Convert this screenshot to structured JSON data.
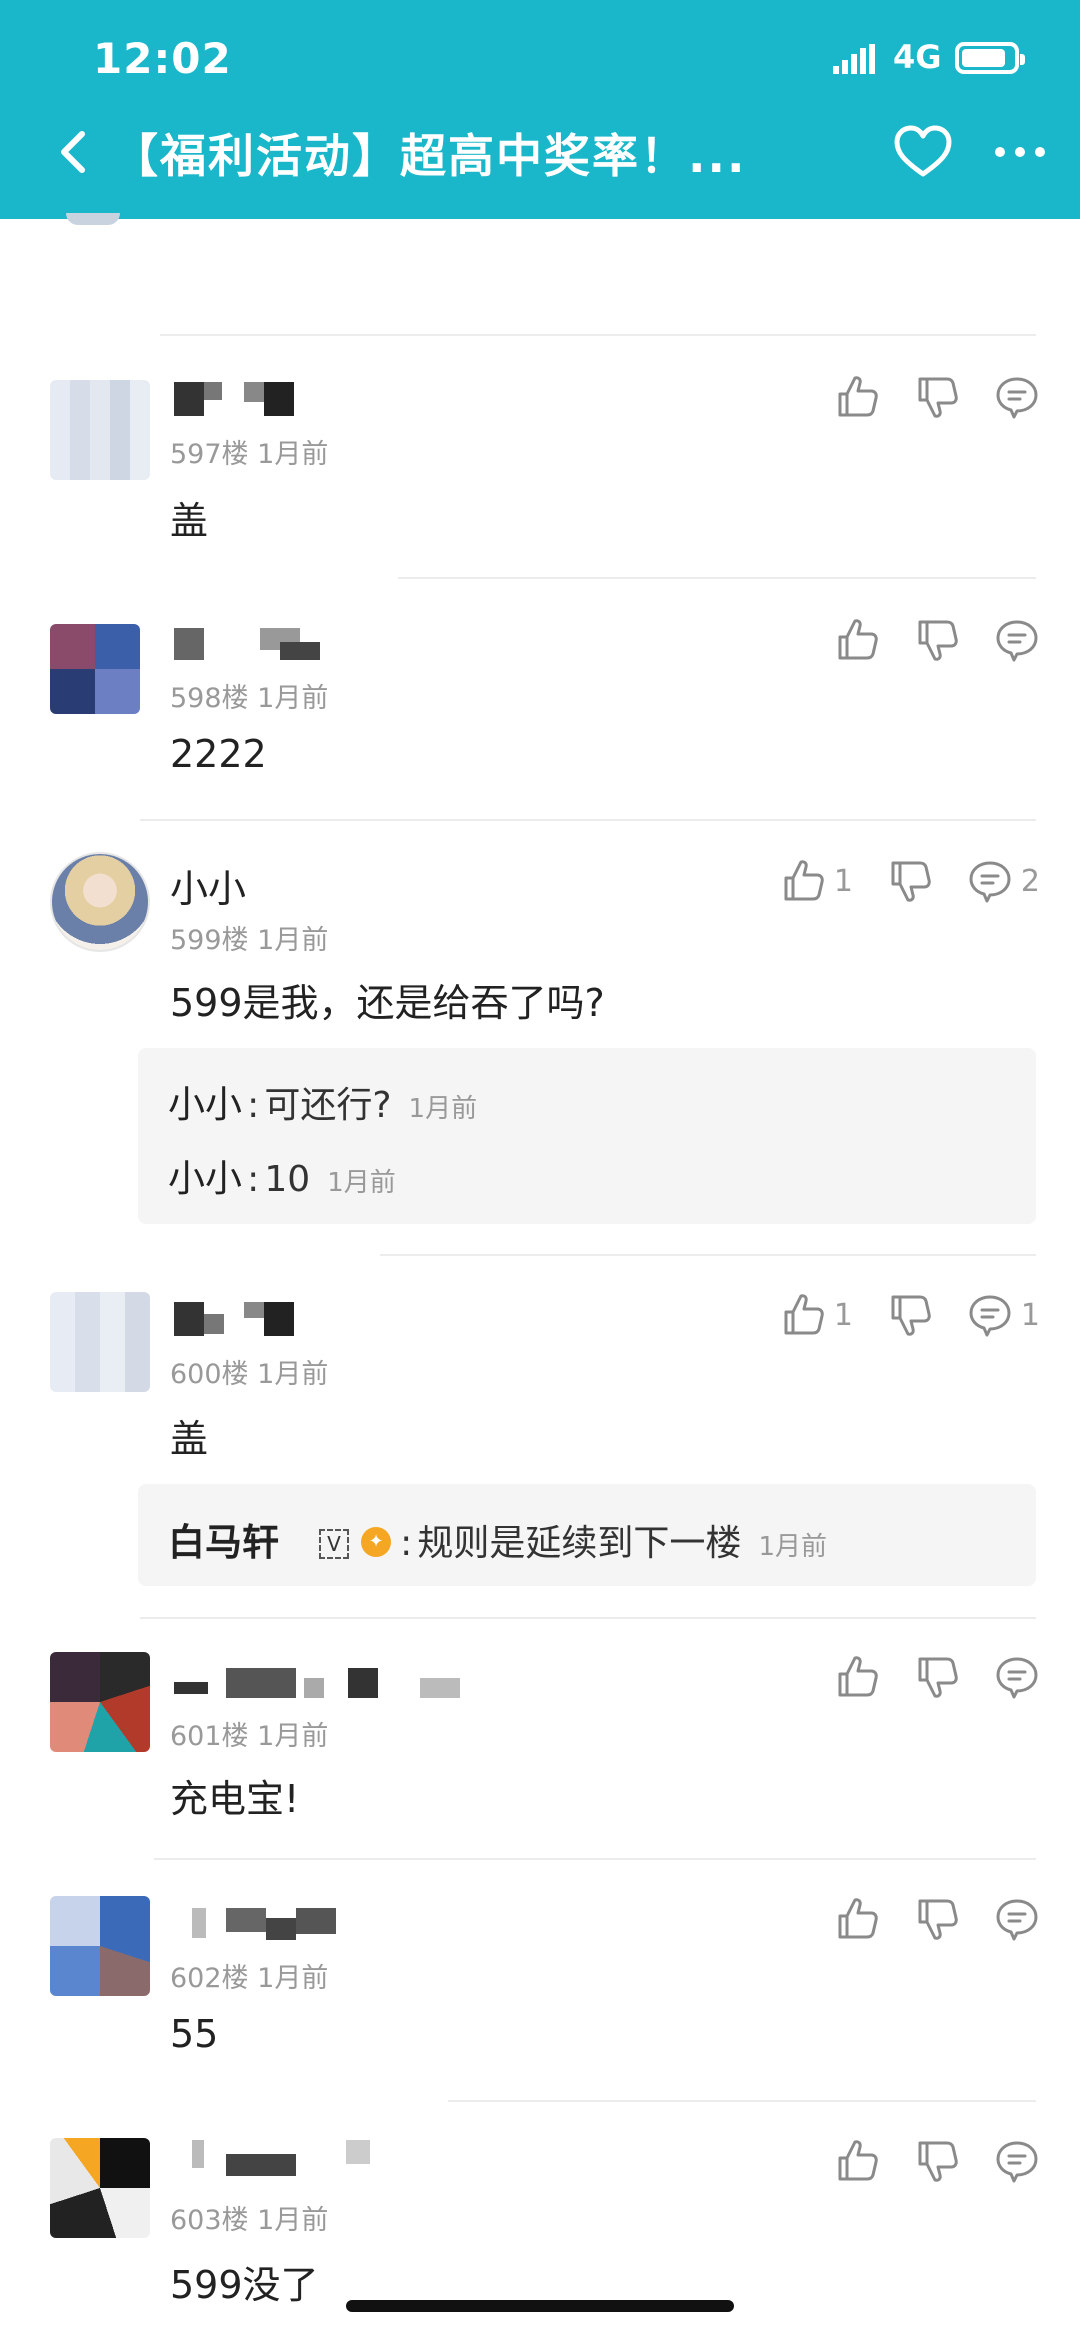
{
  "status_bar": {
    "time": "12:02",
    "network": "4G"
  },
  "header": {
    "title": "【福利活动】超高中奖率！..."
  },
  "floors": [
    {
      "floor": "597楼",
      "time": "1月前",
      "content": "盖",
      "likes": "",
      "comments": ""
    },
    {
      "floor": "598楼",
      "time": "1月前",
      "content": "2222",
      "likes": "",
      "comments": ""
    },
    {
      "username": "小小",
      "floor": "599楼",
      "time": "1月前",
      "content": "599是我，还是给吞了吗?",
      "likes": "1",
      "comments": "2",
      "replies": [
        {
          "name": "小小",
          "sep": ":",
          "text": "可还行?",
          "time": "1月前"
        },
        {
          "name": "小小",
          "sep": ":",
          "text": "10",
          "time": "1月前"
        }
      ]
    },
    {
      "floor": "600楼",
      "time": "1月前",
      "content": "盖",
      "likes": "1",
      "comments": "1",
      "replies": [
        {
          "name": "白马轩",
          "badge": "V",
          "sep": ":",
          "text": "规则是延续到下一楼",
          "time": "1月前"
        }
      ]
    },
    {
      "floor": "601楼",
      "time": "1月前",
      "content": "充电宝!",
      "likes": "",
      "comments": ""
    },
    {
      "floor": "602楼",
      "time": "1月前",
      "content": "55",
      "likes": "",
      "comments": ""
    },
    {
      "floor": "603楼",
      "time": "1月前",
      "content": "599没了",
      "likes": "",
      "comments": ""
    }
  ],
  "icons": {
    "back": "chevron-left-icon",
    "favorite": "heart-icon",
    "more": "more-dots-icon",
    "like": "thumbs-up-icon",
    "dislike": "thumbs-down-icon",
    "comment": "comment-bubble-icon"
  },
  "colors": {
    "header_bg": "#19b7c9",
    "reply_bg": "#f5f5f5",
    "meta_gray": "#999999",
    "badge_orange": "#f5a623"
  }
}
